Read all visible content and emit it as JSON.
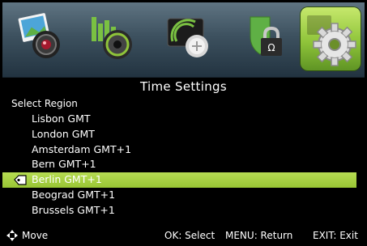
{
  "menu_icons": [
    {
      "name": "picture-icon"
    },
    {
      "name": "sound-icon"
    },
    {
      "name": "channel-icon"
    },
    {
      "name": "lock-icon"
    },
    {
      "name": "settings-icon"
    }
  ],
  "colors": {
    "selection": "#a7d144",
    "accent_green": "#8fc43a"
  },
  "title": "Time Settings",
  "subtitle": "Select Region",
  "regions": [
    {
      "label": "Lisbon GMT",
      "selected": false
    },
    {
      "label": "London GMT",
      "selected": false
    },
    {
      "label": "Amsterdam GMT+1",
      "selected": false
    },
    {
      "label": "Bern GMT+1",
      "selected": false
    },
    {
      "label": "Berlin GMT+1",
      "selected": true
    },
    {
      "label": "Beograd GMT+1",
      "selected": false
    },
    {
      "label": "Brussels GMT+1",
      "selected": false
    }
  ],
  "help": {
    "move": "Move",
    "select": "OK: Select",
    "return": "MENU: Return",
    "exit": "EXIT: Exit"
  }
}
